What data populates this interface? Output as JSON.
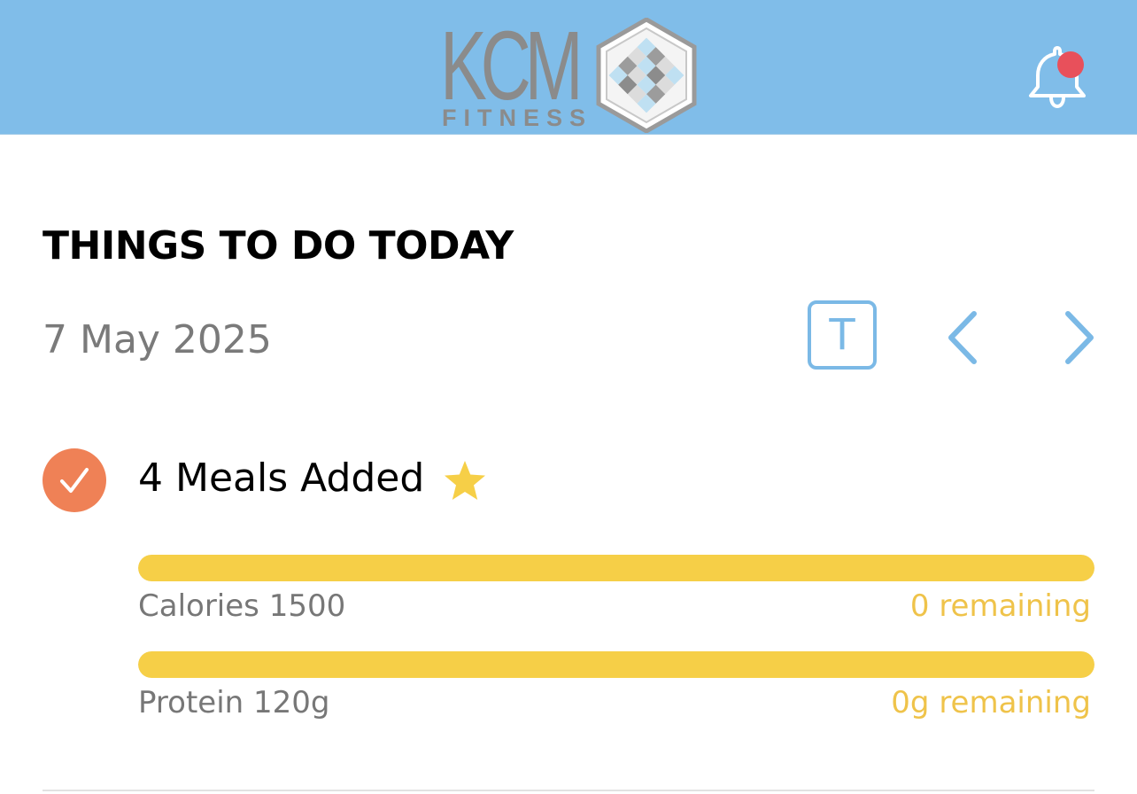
{
  "header": {
    "logo_main": "KCM",
    "logo_sub": "FITNESS",
    "bg_color": "#80bde9",
    "notification_icon": "bell-icon",
    "has_notification_dot": true,
    "notification_dot_color": "#e8505b"
  },
  "todo": {
    "title": "THINGS TO DO TODAY",
    "date": "7 May 2025",
    "today_button_label": "T",
    "prev_icon": "chevron-left-icon",
    "next_icon": "chevron-right-icon",
    "accent_color": "#7bb9e6"
  },
  "task": {
    "label": "4 Meals Added",
    "completed": true,
    "check_color": "#ef8156",
    "star_icon": "star-icon",
    "star_color": "#f6cf47"
  },
  "metrics": [
    {
      "label": "Calories 1500",
      "remaining": "0 remaining",
      "progress_fraction": 1.0
    },
    {
      "label": "Protein 120g",
      "remaining": "0g remaining",
      "progress_fraction": 1.0
    }
  ],
  "colors": {
    "progress_fill": "#f6cf47",
    "remaining_text": "#efc34a"
  }
}
